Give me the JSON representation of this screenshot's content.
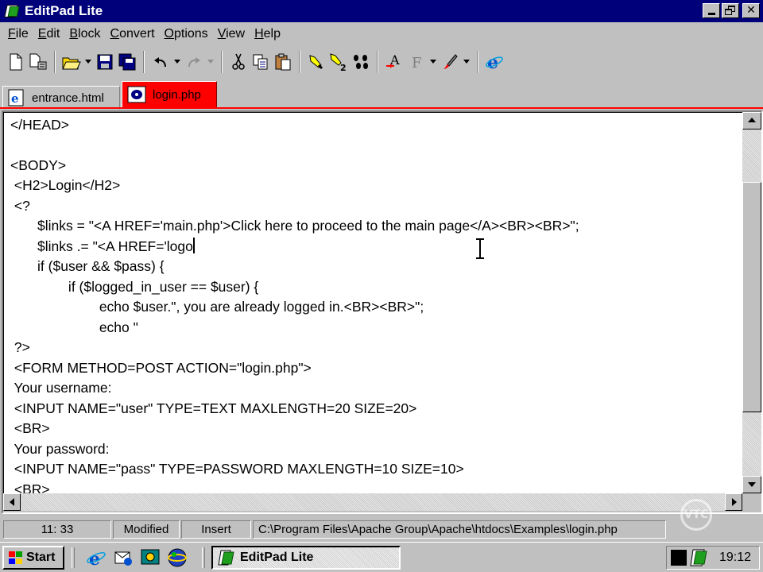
{
  "window": {
    "title": "EditPad Lite"
  },
  "menu": [
    {
      "label": "File"
    },
    {
      "label": "Edit"
    },
    {
      "label": "Block"
    },
    {
      "label": "Convert"
    },
    {
      "label": "Options"
    },
    {
      "label": "View"
    },
    {
      "label": "Help"
    }
  ],
  "tabs": [
    {
      "label": "entrance.html",
      "icon": "ie-file-icon",
      "active": false
    },
    {
      "label": "login.php",
      "icon": "php-file-icon",
      "active": true
    }
  ],
  "editor": {
    "lines": [
      "</HEAD>",
      "",
      "<BODY>",
      " <H2>Login</H2>",
      " <?",
      "       $links = \"<A HREF='main.php'>Click here to proceed to the main page</A><BR><BR>\";",
      "       $links .= \"<A HREF='logo",
      "       if ($user && $pass) {",
      "               if ($logged_in_user == $user) {",
      "                       echo $user.\", you are already logged in.<BR><BR>\";",
      "                       echo \"",
      " ?>",
      " <FORM METHOD=POST ACTION=\"login.php\">",
      " Your username:",
      " <INPUT NAME=\"user\" TYPE=TEXT MAXLENGTH=20 SIZE=20>",
      " <BR>",
      " Your password:",
      " <INPUT NAME=\"pass\" TYPE=PASSWORD MAXLENGTH=10 SIZE=10>",
      " <BR>"
    ]
  },
  "status": {
    "position": "11: 33",
    "modified": "Modified",
    "mode": "Insert",
    "path": "C:\\Program Files\\Apache Group\\Apache\\htdocs\\Examples\\login.php"
  },
  "taskbar": {
    "start_label": "Start",
    "task_label": "EditPad Lite",
    "clock": "19:12"
  },
  "colors": {
    "titlebar": "#00007b",
    "active_tab": "#ff0000",
    "chrome": "#c0c0c0"
  }
}
